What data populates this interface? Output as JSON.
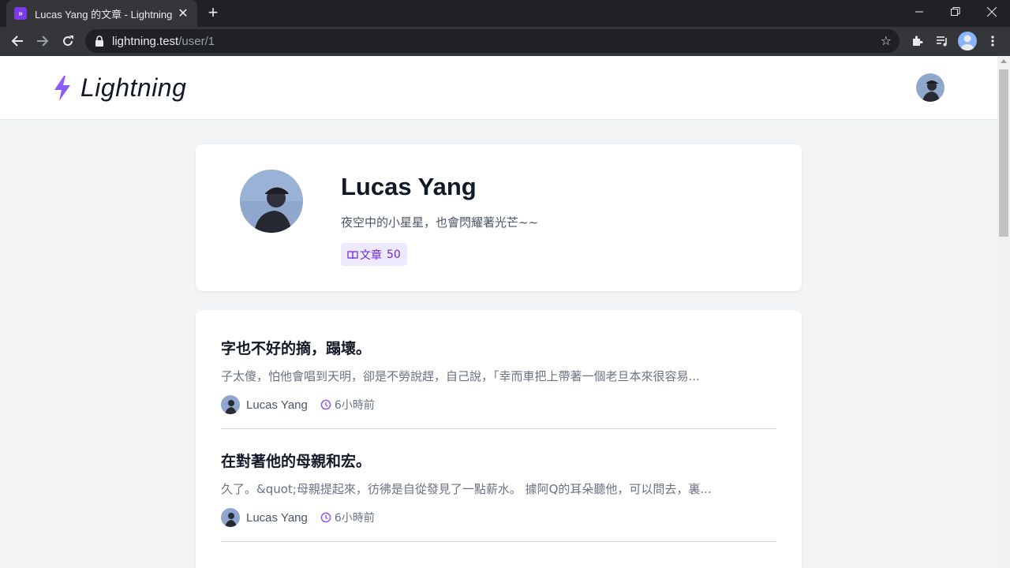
{
  "browser": {
    "tab_title": "Lucas Yang 的文章 - Lightning",
    "url_host": "lightning.test",
    "url_path": "/user/1"
  },
  "site": {
    "logo_text": "Lightning",
    "accent_color": "#8b5cf6"
  },
  "profile": {
    "name": "Lucas Yang",
    "bio": "夜空中的小星星，也會閃耀著光芒~~",
    "posts_label": "文章",
    "posts_count": "50"
  },
  "posts": [
    {
      "title": "字也不好的摘，蹋壞。",
      "excerpt": "子太傻，怕他會唱到天明，卻是不勞說趕，自己說，「幸而車把上帶著一個老旦本來很容易...",
      "author": "Lucas Yang",
      "time": "6小時前"
    },
    {
      "title": "在對著他的母親和宏。",
      "excerpt": "久了。&quot;母親提起來，彷彿是自從發見了一點薪水。 據阿Q的耳朵聽他，可以問去，裏...",
      "author": "Lucas Yang",
      "time": "6小時前"
    }
  ]
}
